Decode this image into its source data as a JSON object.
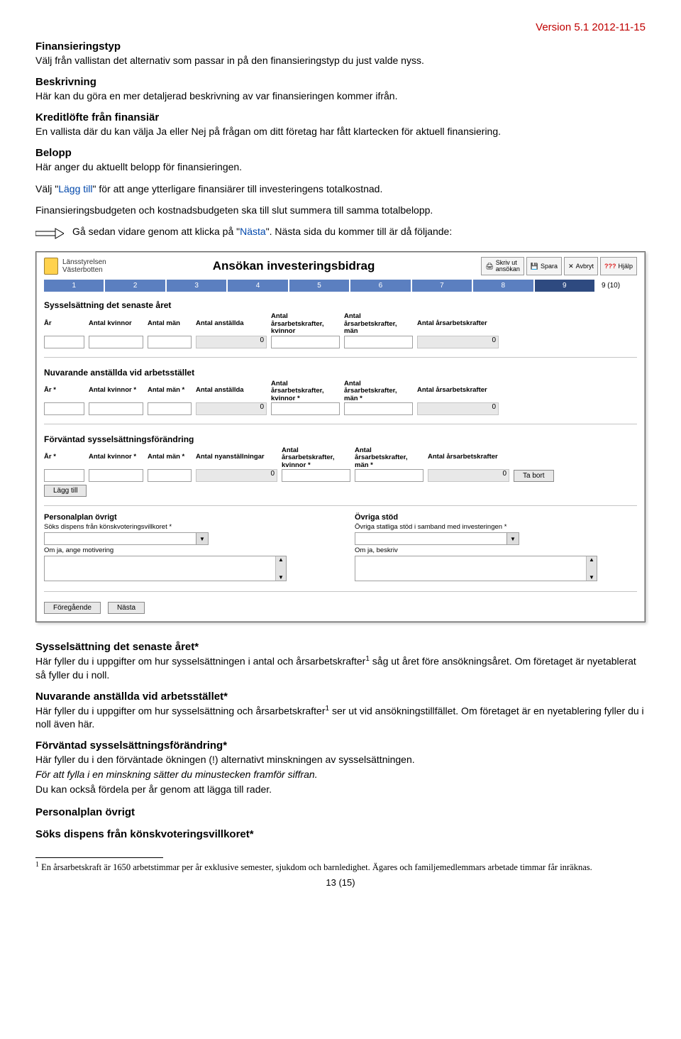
{
  "header": {
    "version": "Version 5.1 2012-11-15"
  },
  "sections": {
    "s1": {
      "title": "Finansieringstyp",
      "p1": "Välj från vallistan det alternativ som passar in på den finansieringstyp du just valde nyss."
    },
    "s2": {
      "title": "Beskrivning",
      "p1": "Här kan du göra en mer detaljerad beskrivning av var finansieringen kommer ifrån."
    },
    "s3": {
      "title": "Kreditlöfte från finansiär",
      "p1": "En vallista där du kan välja Ja eller Nej på frågan om ditt företag har fått klartecken för aktuell finansiering."
    },
    "s4": {
      "title": "Belopp",
      "p1": "Här anger du aktuellt belopp för finansieringen."
    },
    "p_valj_pre": "Välj \"",
    "p_valj_link": "Lägg till",
    "p_valj_post": "\" för att ange ytterligare finansiärer till investeringens totalkostnad.",
    "p_sum": "Finansieringsbudgeten och kostnadsbudgeten ska till slut summera till samma totalbelopp.",
    "arrow_pre": "Gå sedan vidare genom att klicka på \"",
    "arrow_link": "Nästa",
    "arrow_post": "\". Nästa sida du kommer till är då följande:",
    "s5": {
      "title": "Sysselsättning det senaste året*",
      "p1a": "Här fyller du i uppgifter om hur sysselsättningen i antal och årsarbetskrafter",
      "p1b": " såg ut året före ansökningsåret. Om företaget är nyetablerat så fyller du i noll."
    },
    "s6": {
      "title": "Nuvarande anställda vid arbetsstället*",
      "p1a": "Här fyller du i uppgifter om hur sysselsättning och årsarbetskrafter",
      "p1b": " ser ut vid ansökningstillfället. Om företaget är en nyetablering fyller du i noll även här."
    },
    "s7": {
      "title": "Förväntad sysselsättningsförändring*",
      "p1": "Här fyller du i den förväntade ökningen (!) alternativt minskningen av sysselsättningen.",
      "p2": "För att fylla i en minskning sätter du minustecken framför siffran.",
      "p3": "Du kan också fördela per år genom att lägga till rader."
    },
    "s8": {
      "title": "Personalplan övrigt"
    },
    "s9": {
      "title": "Söks dispens från könskvoteringsvillkoret*"
    }
  },
  "app": {
    "logo_line1": "Länsstyrelsen",
    "logo_line2": "Västerbotten",
    "title": "Ansökan investeringsbidrag",
    "buttons": {
      "print": "Skriv ut\nansökan",
      "save": "Spara",
      "cancel": "Avbryt",
      "help": "Hjälp"
    },
    "steps": [
      "1",
      "2",
      "3",
      "4",
      "5",
      "6",
      "7",
      "8",
      "9"
    ],
    "step_count": "9 (10)",
    "sec1": {
      "title": "Sysselsättning det senaste året",
      "cols": {
        "ar": "År",
        "kvinnor": "Antal kvinnor",
        "man": "Antal män",
        "anst": "Antal anställda",
        "akv": "Antal\nårsarbetskrafter,\nkvinnor",
        "aman": "Antal\nårsarbetskrafter,\nmän",
        "atot": "Antal årsarbetskrafter"
      },
      "zero": "0"
    },
    "sec2": {
      "title": "Nuvarande anställda vid arbetsstället",
      "cols": {
        "ar": "År *",
        "kvinnor": "Antal kvinnor *",
        "man": "Antal män *",
        "anst": "Antal anställda",
        "akv": "Antal\nårsarbetskrafter,\nkvinnor *",
        "aman": "Antal\nårsarbetskrafter,\nmän *",
        "atot": "Antal årsarbetskrafter"
      },
      "zero": "0"
    },
    "sec3": {
      "title": "Förväntad sysselsättningsförändring",
      "cols": {
        "ar": "År *",
        "kvinnor": "Antal kvinnor *",
        "man": "Antal män *",
        "anst": "Antal nyanställningar",
        "akv": "Antal\nårsarbetskrafter,\nkvinnor *",
        "aman": "Antal\nårsarbetskrafter,\nmän *",
        "atot": "Antal årsarbetskrafter"
      },
      "zero": "0",
      "add": "Lägg till",
      "remove": "Ta bort"
    },
    "sec4": {
      "left_title": "Personalplan övrigt",
      "left_q": "Söks dispens från könskvoteringsvillkoret *",
      "left_sub": "Om ja, ange motivering",
      "right_title": "Övriga stöd",
      "right_q": "Övriga statliga stöd i samband med investeringen *",
      "right_sub": "Om ja, beskriv"
    },
    "nav": {
      "prev": "Föregående",
      "next": "Nästa"
    }
  },
  "footnote": {
    "marker": "1",
    "text": " En årsarbetskraft är 1650 arbetstimmar per år exklusive semester, sjukdom och barnledighet. Ägares och familjemedlemmars arbetade timmar får inräknas."
  },
  "page_num": "13 (15)",
  "sup1": "1"
}
